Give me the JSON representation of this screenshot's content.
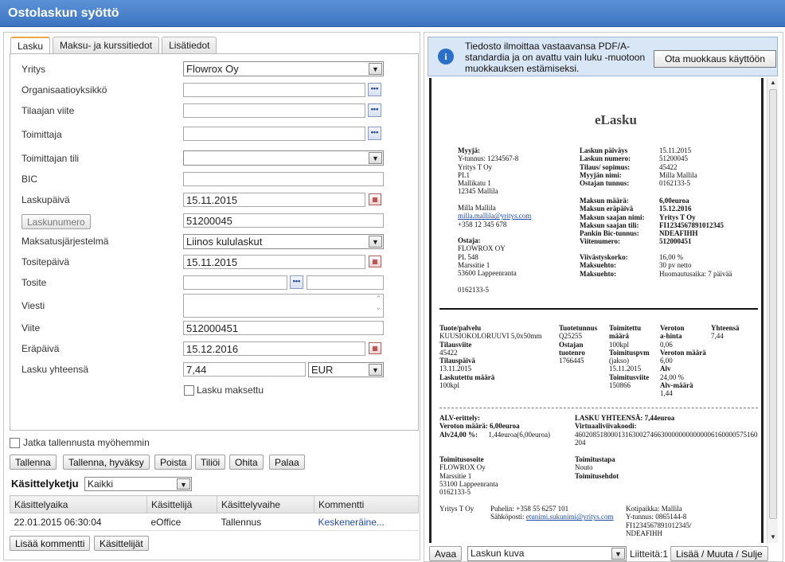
{
  "title": "Ostolaskun syöttö",
  "tabs": [
    "Lasku",
    "Maksu- ja kurssitiedot",
    "Lisätiedot"
  ],
  "form": {
    "yritys_label": "Yritys",
    "yritys_value": "Flowrox Oy",
    "org_label": "Organisaatioyksikkö",
    "tilaajan_viite_label": "Tilaajan viite",
    "toimittaja_label": "Toimittaja",
    "toimittajan_tili_label": "Toimittajan tili",
    "bic_label": "BIC",
    "laskupaiva_label": "Laskupäivä",
    "laskupaiva_value": "15.11.2015",
    "laskunumero_btn": "Laskunumero",
    "laskunumero_value": "51200045",
    "maksatus_label": "Maksatusjärjestelmä",
    "maksatus_value": "Liinos kululaskut",
    "tositepaiva_label": "Tositepäivä",
    "tositepaiva_value": "15.11.2015",
    "tosite_label": "Tosite",
    "viesti_label": "Viesti",
    "viite_label": "Viite",
    "viite_value": "512000451",
    "erapaiva_label": "Eräpäivä",
    "erapaiva_value": "15.12.2016",
    "yhteensa_label": "Lasku yhteensä",
    "yhteensa_value": "7,44",
    "currency": "EUR",
    "maksettu_label": "Lasku maksettu"
  },
  "jatka_label": "Jatka tallennusta myöhemmin",
  "actions": [
    "Tallenna",
    "Tallenna, hyväksy",
    "Poista",
    "Tiliöi",
    "Ohita",
    "Palaa"
  ],
  "ketju": {
    "label": "Käsittelyketju",
    "value": "Kaikki"
  },
  "table": {
    "headers": [
      "Käsittelyaika",
      "Käsittelijä",
      "Käsittelyvaihe",
      "Kommentti"
    ],
    "rows": [
      [
        "22.01.2015 06:30:04",
        "eOffice",
        "Tallennus",
        "Keskeneräine..."
      ]
    ]
  },
  "bottom_buttons": [
    "Lisää kommentti",
    "Käsittelijät"
  ],
  "notice": {
    "text": "Tiedosto ilmoittaa vastaavansa PDF/A-standardia ja on avattu vain luku -muotoon muokkauksen estämiseksi.",
    "button": "Ota muokkaus käyttöön"
  },
  "doc": {
    "heading": "eLasku",
    "seller": [
      "Myyjä:",
      "Y-tunnus: 1234567-8",
      "Yritys T Oy",
      "PL1",
      "Mallikatu 1",
      "12345 Mallila"
    ],
    "contact": [
      "Milla Mallila",
      "milla.mallila@yritys.com",
      "+358 12 345 678"
    ],
    "buyer": [
      "Ostaja:",
      "FLOWROX OY",
      "PL 548",
      "Marssitie 1",
      "53600 Lappeenranta",
      "",
      "0162133-5"
    ],
    "info_labels": [
      "Laskun päiväys",
      "Laskun numero:",
      "Tilaus/ sopimus:",
      "Myyjän nimi:",
      "Ostajan tunnus:"
    ],
    "info_values": [
      "15.11.2015",
      "51200045",
      "45422",
      "Milla Mallila",
      "0162133-5"
    ],
    "pay_labels": [
      "Maksun määrä:",
      "Maksun eräpäivä",
      "Maksun saajan nimi:",
      "Maksun saajan tili:",
      "Pankin Bic-tunnus:",
      "Viitenumero:"
    ],
    "pay_values": [
      "6,00euroa",
      "15.12.2016",
      "Yritys T Oy",
      "FI1234567891012345",
      "NDEAFIHH",
      "512000451"
    ],
    "misc_labels": [
      "Viivästyskorko:",
      "Maksuehto:",
      "Maksuehto:"
    ],
    "misc_values": [
      "16,00 %",
      "30 pv netto",
      "Huomautusaika: 7 päivää"
    ],
    "row": {
      "c1": [
        "Tuote/palvelu",
        "KUUSIOKOLORUUVI 5,0x50mm",
        "Tilausviite",
        "45422",
        "Tilauspäivä",
        "13.11.2015",
        "Laskutettu määrä",
        "100kpl"
      ],
      "c2": [
        "Tuotetunnus",
        "Q25255",
        "Ostajan",
        "tuotenro",
        "1766445"
      ],
      "c3": [
        "Toimitettu",
        "määrä",
        "100kpl",
        "Toimituspvm",
        "(jakso)",
        "15.11.2015",
        "Toimitusviite",
        "150866"
      ],
      "c4": [
        "Veroton",
        "a-hinta",
        "0,06",
        "Veroton määrä",
        "6,00",
        "Alv",
        "24,00 %",
        "Alv-määrä",
        "1,44"
      ],
      "c5": [
        "Yhteensä",
        "7,44"
      ]
    },
    "alv": [
      "ALV-erittely:",
      "Veroton määrä: 6,00euroa",
      "Alv24,00 %:",
      "1,44euroa(6,00euroa)"
    ],
    "total": [
      "LASKU YHTEENSÄ: 7,44euroa",
      "Virtuaaliviivakoodi:",
      "460208518000131630027466300000000000006160000575160",
      "204"
    ],
    "deliv_addr": [
      "Toimitusosoite",
      "FLOWROX Oy",
      "Marssitie 1",
      "53100 Lappeenranta",
      "0162133-5"
    ],
    "deliv_terms": [
      "Toimitustapa",
      "Nouto",
      "Toimitusehdot"
    ],
    "footer_left": "Yritys T Oy",
    "footer_mid": [
      "Puhelin: +358 55 6257 101",
      "Sähköposti:",
      "etunimi.sukunimi@yritys.com"
    ],
    "footer_right": [
      "Kotipaikka: Mallila",
      "Y-tunnus: 0865144-8",
      "FI1234567891012345/",
      "NDEAFIHH"
    ]
  },
  "viewer": {
    "open_btn": "Avaa",
    "select_value": "Laskun kuva",
    "attachments": "Liitteitä:1",
    "edit_btn": "Lisää / Muuta / Sulje"
  }
}
